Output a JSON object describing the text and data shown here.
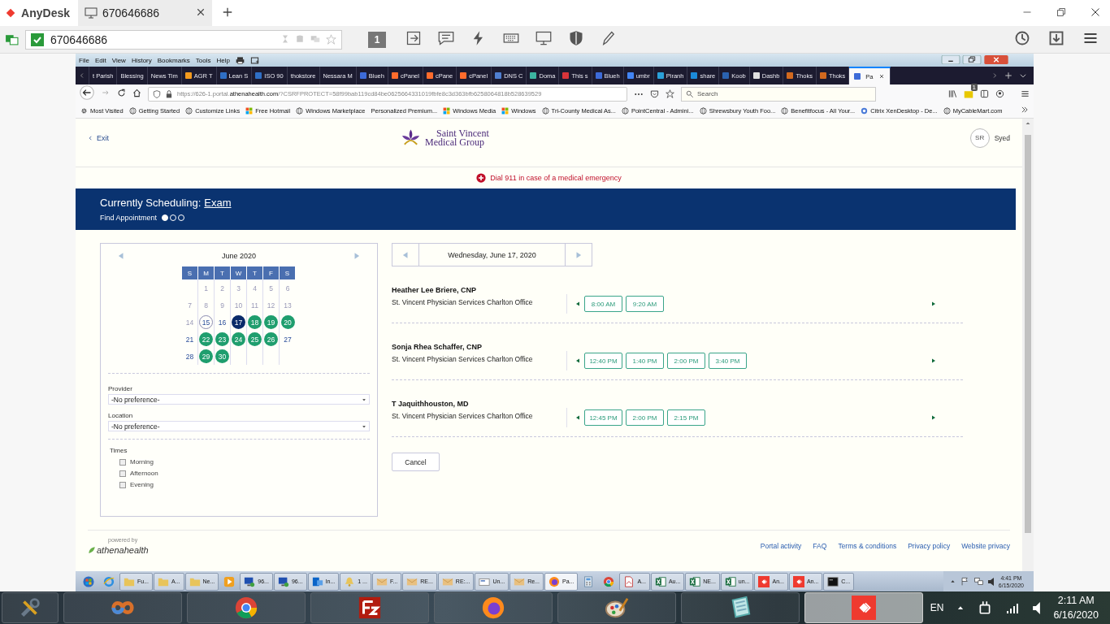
{
  "anydesk": {
    "app_name": "AnyDesk",
    "session_tab": {
      "label": "670646686"
    },
    "address": "670646686",
    "display_number": "1"
  },
  "firefox": {
    "menu": [
      "File",
      "Edit",
      "View",
      "History",
      "Bookmarks",
      "Tools",
      "Help"
    ],
    "tabs": [
      {
        "label": "t Parish",
        "kind": "text",
        "selected": false
      },
      {
        "label": "Blessing",
        "kind": "text",
        "selected": false
      },
      {
        "label": "News Tim",
        "kind": "text",
        "selected": false
      },
      {
        "label": "AGR T",
        "kind": "icon",
        "color": "#f39a1e",
        "selected": false
      },
      {
        "label": "Lean S",
        "kind": "icon",
        "color": "#2f6fc4",
        "selected": false
      },
      {
        "label": "ISO 90",
        "kind": "icon",
        "color": "#2f6fc4",
        "selected": false
      },
      {
        "label": "thokstore",
        "kind": "text",
        "selected": false
      },
      {
        "label": "Nessara M",
        "kind": "text",
        "selected": false
      },
      {
        "label": "Blueh",
        "kind": "icon",
        "color": "#3d6bd8",
        "selected": false
      },
      {
        "label": "cPanel",
        "kind": "icon",
        "color": "#ff6c2c",
        "selected": false
      },
      {
        "label": "cPane",
        "kind": "icon",
        "color": "#ff6c2c",
        "selected": false
      },
      {
        "label": "cPanel",
        "kind": "icon",
        "color": "#ff6c2c",
        "selected": false
      },
      {
        "label": "DNS C",
        "kind": "icon",
        "color": "#4f7fd0",
        "selected": false
      },
      {
        "label": "Doma",
        "kind": "icon",
        "color": "#3cb4a0",
        "selected": false
      },
      {
        "label": "This s",
        "kind": "icon",
        "color": "#d8343a",
        "selected": false
      },
      {
        "label": "Blueh",
        "kind": "icon",
        "color": "#3d6bd8",
        "selected": false
      },
      {
        "label": "umbr",
        "kind": "icon",
        "color": "#4285f4",
        "selected": false
      },
      {
        "label": "Piranh",
        "kind": "icon",
        "color": "#2aa0d8",
        "selected": false
      },
      {
        "label": "share",
        "kind": "icon",
        "color": "#1b8ad8",
        "selected": false
      },
      {
        "label": "Koob",
        "kind": "icon",
        "color": "#2a62b0",
        "selected": false
      },
      {
        "label": "Dashb",
        "kind": "icon",
        "color": "#e0e0e0",
        "selected": false
      },
      {
        "label": "Thoks",
        "kind": "icon",
        "color": "#d2691e",
        "selected": false
      },
      {
        "label": "Thoks",
        "kind": "icon",
        "color": "#d2691e",
        "selected": false
      },
      {
        "label": "Pa",
        "kind": "icon",
        "color": "#3d6bd8",
        "selected": true
      }
    ],
    "url_prefix": "https://626-1.portal.",
    "url_domain": "athenahealth.com",
    "url_rest": "/?CSRFPROTECT=58f99bab119cd84be0625664331019fbfe8c3d363bfb6258064818b528639529",
    "search": {
      "placeholder": "Search"
    },
    "notification_badge": "1",
    "bookmarks": [
      {
        "label": "Most Visited",
        "kind": "gear"
      },
      {
        "label": "Getting Started",
        "kind": "globe"
      },
      {
        "label": "Customize Links",
        "kind": "globe"
      },
      {
        "label": "Free Hotmail",
        "kind": "windows"
      },
      {
        "label": "Windows Marketplace",
        "kind": "globe"
      },
      {
        "label": "Personalized Premium...",
        "kind": "none"
      },
      {
        "label": "Windows Media",
        "kind": "windows"
      },
      {
        "label": "Windows",
        "kind": "windows"
      },
      {
        "label": "Tri-County Medical As...",
        "kind": "globe"
      },
      {
        "label": "PointCentral - Admini...",
        "kind": "globe"
      },
      {
        "label": "Shrewsbury Youth Foo...",
        "kind": "globe"
      },
      {
        "label": "Benefitfocus - All Your...",
        "kind": "globe"
      },
      {
        "label": "Citrix XenDesktop - De...",
        "kind": "citrix"
      },
      {
        "label": "MyCableMart.com",
        "kind": "globe"
      }
    ]
  },
  "page": {
    "exit": "Exit",
    "logo": [
      "Saint Vincent",
      "Medical Group"
    ],
    "user_initials": "SR",
    "user_name": "Syed",
    "emergency": "Dial 911 in case of a medical emergency",
    "banner": {
      "label": "Currently Scheduling:",
      "link": "Exam",
      "step_label": "Find Appointment",
      "steps": [
        {
          "selected": true
        },
        {
          "selected": false
        },
        {
          "selected": false
        }
      ]
    },
    "calendar": {
      "month": "June 2020",
      "weekdays": [
        "S",
        "M",
        "T",
        "W",
        "T",
        "F",
        "S"
      ],
      "weeks": [
        [
          {
            "kind": "blank"
          },
          {
            "day": "1",
            "kind": "past"
          },
          {
            "day": "2",
            "kind": "past"
          },
          {
            "day": "3",
            "kind": "past"
          },
          {
            "day": "4",
            "kind": "past"
          },
          {
            "day": "5",
            "kind": "past"
          },
          {
            "day": "6",
            "kind": "past"
          }
        ],
        [
          {
            "day": "7",
            "kind": "past"
          },
          {
            "day": "8",
            "kind": "past"
          },
          {
            "day": "9",
            "kind": "past"
          },
          {
            "day": "10",
            "kind": "past"
          },
          {
            "day": "11",
            "kind": "past"
          },
          {
            "day": "12",
            "kind": "past"
          },
          {
            "day": "13",
            "kind": "past"
          }
        ],
        [
          {
            "day": "14",
            "kind": "past"
          },
          {
            "day": "15",
            "kind": "today"
          },
          {
            "day": "16",
            "kind": "unavailable"
          },
          {
            "day": "17",
            "kind": "selected"
          },
          {
            "day": "18",
            "kind": "available"
          },
          {
            "day": "19",
            "kind": "available"
          },
          {
            "day": "20",
            "kind": "available"
          }
        ],
        [
          {
            "day": "21",
            "kind": "unavailable"
          },
          {
            "day": "22",
            "kind": "available"
          },
          {
            "day": "23",
            "kind": "available"
          },
          {
            "day": "24",
            "kind": "available"
          },
          {
            "day": "25",
            "kind": "available"
          },
          {
            "day": "26",
            "kind": "available"
          },
          {
            "day": "27",
            "kind": "unavailable"
          }
        ],
        [
          {
            "day": "28",
            "kind": "unavailable"
          },
          {
            "day": "29",
            "kind": "available"
          },
          {
            "day": "30",
            "kind": "available"
          }
        ]
      ]
    },
    "filters": [
      {
        "label": "Provider",
        "value": "-No preference-"
      },
      {
        "label": "Location",
        "value": "-No preference-"
      }
    ],
    "times": {
      "label": "Times",
      "options": [
        {
          "label": "Morning",
          "checked": false
        },
        {
          "label": "Afternoon",
          "checked": false
        },
        {
          "label": "Evening",
          "checked": false
        }
      ]
    },
    "date": "Wednesday, June 17, 2020",
    "providers": [
      {
        "name": "Heather Lee Briere, CNP",
        "office": "St. Vincent Physician Services Charlton Office",
        "slots": [
          "8:00 AM",
          "9:20 AM"
        ]
      },
      {
        "name": "Sonja Rhea Schaffer, CNP",
        "office": "St. Vincent Physician Services Charlton Office",
        "slots": [
          "12:40 PM",
          "1:40 PM",
          "2:00 PM",
          "3:40 PM"
        ]
      },
      {
        "name": "T Jaquithhouston, MD",
        "office": "St. Vincent Physician Services Charlton Office",
        "slots": [
          "12:45 PM",
          "2:00 PM",
          "2:15 PM"
        ]
      }
    ],
    "cancel": "Cancel",
    "footer": {
      "powered_by": "powered by",
      "brand": "athenahealth",
      "links": [
        "Portal activity",
        "FAQ",
        "Terms & conditions",
        "Privacy policy",
        "Website privacy"
      ]
    }
  },
  "remote_taskbar": {
    "items": [
      {
        "kind": "orb",
        "selected": false
      },
      {
        "kind": "ie",
        "selected": false
      },
      {
        "kind": "folder",
        "label": "Fu...",
        "selected": false
      },
      {
        "kind": "folder",
        "label": "A...",
        "selected": false
      },
      {
        "kind": "folder",
        "label": "Ne...",
        "selected": false
      },
      {
        "kind": "media",
        "selected": false
      },
      {
        "kind": "rdp",
        "label": "96...",
        "selected": false
      },
      {
        "kind": "rdp",
        "label": "96...",
        "selected": false
      },
      {
        "kind": "outlook",
        "label": "In...",
        "selected": false
      },
      {
        "kind": "bell",
        "label": "1 ...",
        "selected": false
      },
      {
        "kind": "mail",
        "label": "F...",
        "selected": false
      },
      {
        "kind": "mail",
        "label": "RE...",
        "selected": false
      },
      {
        "kind": "mail",
        "label": "RE:...",
        "selected": false
      },
      {
        "kind": "envelope",
        "label": "Un...",
        "selected": false
      },
      {
        "kind": "mail",
        "label": "Re...",
        "selected": false
      },
      {
        "kind": "firefox",
        "label": "Pa...",
        "selected": true
      },
      {
        "kind": "calc",
        "selected": false
      },
      {
        "kind": "chrome",
        "selected": false
      },
      {
        "kind": "pdf",
        "label": "A...",
        "selected": false
      },
      {
        "kind": "excel",
        "label": "Au...",
        "selected": false
      },
      {
        "kind": "excel",
        "label": "NE...",
        "selected": false
      },
      {
        "kind": "excel",
        "label": "un...",
        "selected": false
      },
      {
        "kind": "anydesk",
        "label": "An...",
        "selected": false
      },
      {
        "kind": "anydesk",
        "label": "An...",
        "selected": false
      },
      {
        "kind": "cmd",
        "label": "C...",
        "selected": false
      }
    ],
    "time": "4:41 PM",
    "date": "6/15/2020"
  },
  "local_taskbar": {
    "items": [
      {
        "kind": "tools",
        "selected": false
      },
      {
        "kind": "vs",
        "selected": false
      },
      {
        "kind": "chrome",
        "selected": false
      },
      {
        "kind": "filezilla",
        "selected": false
      },
      {
        "kind": "firefox",
        "selected": false
      },
      {
        "kind": "paint",
        "selected": false
      },
      {
        "kind": "notepad",
        "selected": false
      },
      {
        "kind": "anydesk",
        "selected": true
      }
    ],
    "language": "EN",
    "time": "2:11 AM",
    "date": "6/16/2020"
  }
}
